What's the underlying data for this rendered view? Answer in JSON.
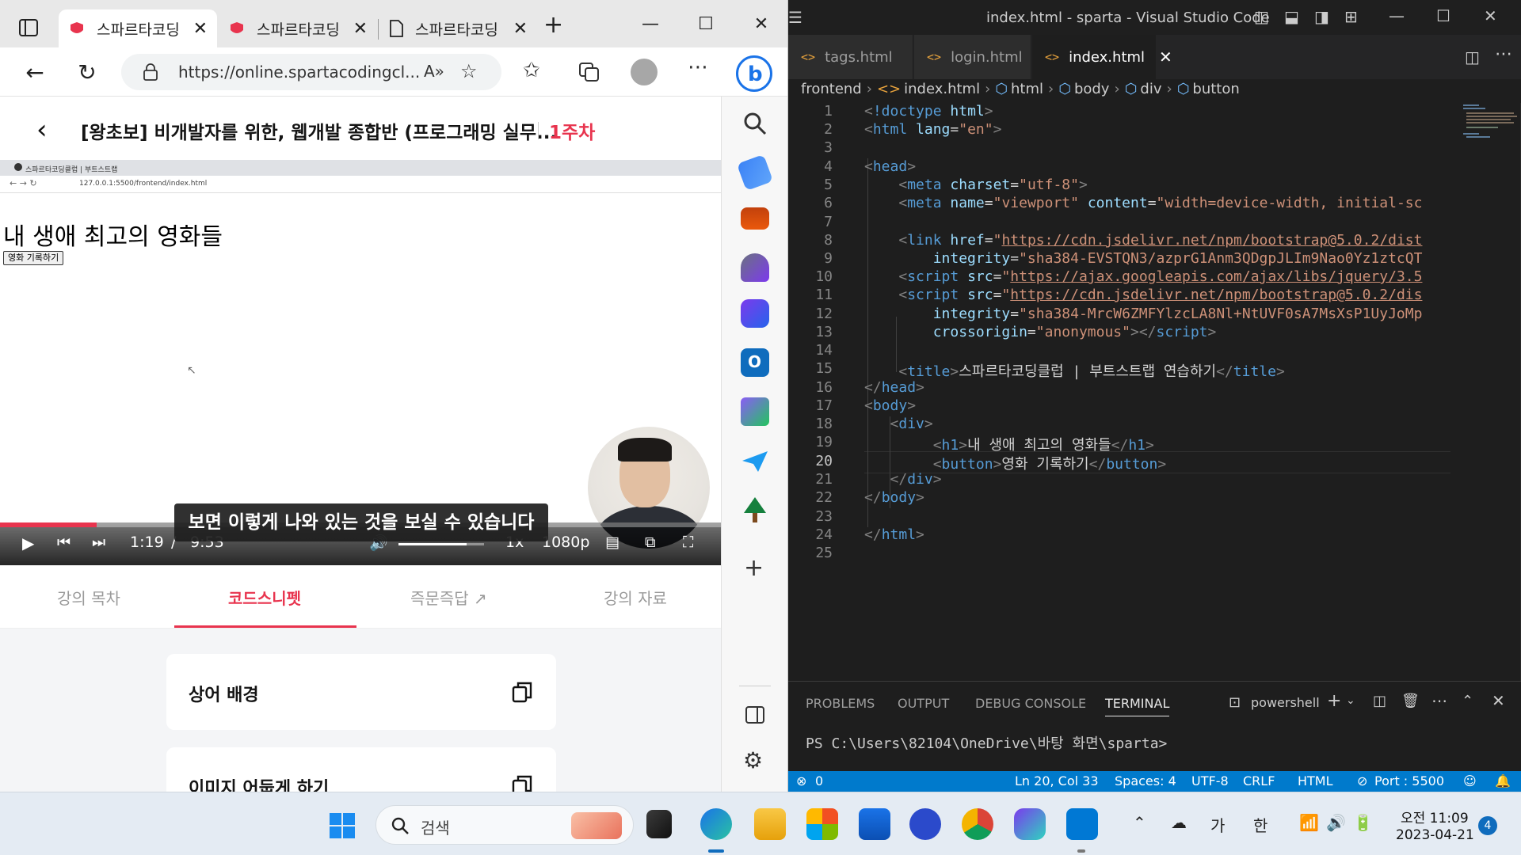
{
  "browser": {
    "tabs": [
      {
        "label": "스파르타코딩",
        "active": true
      },
      {
        "label": "스파르타코딩",
        "active": false
      },
      {
        "label": "스파르타코딩",
        "active": false
      }
    ],
    "tab_close": "✕",
    "new_tab": "+",
    "url": "https://online.spartacodingcl...",
    "window_buttons": {
      "minimize": "—",
      "maximize": "☐",
      "close": "✕"
    }
  },
  "course": {
    "title": "[왕초보] 비개발자를 위한, 웹개발 종합반 (프로그래밍 실무...",
    "week": "1주차",
    "tabs": [
      "강의 목차",
      "코드스니펫",
      "즉문즉답",
      "강의 자료"
    ],
    "active_tab": "코드스니펫",
    "snippets": [
      "상어 배경",
      "이미지 어둡게 하기"
    ]
  },
  "video": {
    "mini_tab": "스파르타코딩클럽 | 부트스트랩",
    "mini_url": "127.0.0.1:5500/frontend/index.html",
    "h1": "내 생애 최고의 영화들",
    "button": "영화 기록하기",
    "subtitle": "보면 이렇게 나와 있는 것을 보실 수 있습니다",
    "current_time": "1:19",
    "time_sep": "/",
    "duration": "9:53",
    "speed": "1x",
    "quality": "1080p",
    "progress_fraction": 0.134,
    "volume_fraction": 0.8
  },
  "vscode": {
    "title": "index.html - sparta - Visual Studio Code",
    "tabs": [
      "tags.html",
      "login.html",
      "index.html"
    ],
    "tab_close": "✕",
    "breadcrumb": [
      "frontend",
      "index.html",
      "html",
      "body",
      "div",
      "button"
    ],
    "line_numbers": [
      "1",
      "2",
      "3",
      "4",
      "5",
      "6",
      "7",
      "8",
      "9",
      "10",
      "11",
      "12",
      "13",
      "14",
      "15",
      "16",
      "17",
      "18",
      "19",
      "20",
      "21",
      "22",
      "23",
      "24",
      "25"
    ],
    "code": {
      "l1_kw": "!doctype",
      "l1_tag": "html",
      "l2_tag": "html",
      "l2_attr": "lang",
      "l2_val": "\"en\"",
      "l4_tag": "head",
      "l5_tag": "meta",
      "l5_attr": "charset",
      "l5_val": "\"utf-8\"",
      "l6_tag": "meta",
      "l6_attr1": "name",
      "l6_val1": "\"viewport\"",
      "l6_attr2": "content",
      "l6_val2": "\"width=device-width, initial-sc",
      "l8_tag": "link",
      "l8_attr": "href",
      "l8_val": "https://cdn.jsdelivr.net/npm/bootstrap@5.0.2/dist",
      "l9_attr": "integrity",
      "l9_val": "\"sha384-EVSTQN3/azprG1Anm3QDgpJLIm9Nao0Yz1ztcQT",
      "l10_tag": "script",
      "l10_attr": "src",
      "l10_val": "https://ajax.googleapis.com/ajax/libs/jquery/3.5",
      "l11_tag": "script",
      "l11_attr": "src",
      "l11_val": "https://cdn.jsdelivr.net/npm/bootstrap@5.0.2/dis",
      "l12_attr": "integrity",
      "l12_val": "\"sha384-MrcW6ZMFYlzcLA8Nl+NtUVF0sA7MsXsP1UyJoMp",
      "l13_attr": "crossorigin",
      "l13_val": "\"anonymous\"",
      "l13_close": "script",
      "l15_tag": "title",
      "l15_text": "스파르타코딩클럽 | 부트스트랩 연습하기",
      "l15_close": "title",
      "l16_tag": "head",
      "l17_tag": "body",
      "l18_tag": "div",
      "l19_tag": "h1",
      "l19_text": "내 생애 최고의 영화들",
      "l19_close": "h1",
      "l20_tag": "button",
      "l20_text": "영화 기록하기",
      "l20_close": "button",
      "l21_tag": "div",
      "l22_tag": "body",
      "l24_tag": "html"
    },
    "panel_tabs": [
      "PROBLEMS",
      "OUTPUT",
      "DEBUG CONSOLE",
      "TERMINAL"
    ],
    "terminal_name": "powershell",
    "prompt": "PS C:\\Users\\82104\\OneDrive\\바탕 화면\\sparta>",
    "status": {
      "errors": "0",
      "position": "Ln 20, Col 33",
      "spaces": "Spaces: 4",
      "encoding": "UTF-8",
      "eol": "CRLF",
      "language": "HTML",
      "port": "Port : 5500"
    }
  },
  "taskbar": {
    "search": "검색",
    "tray_ime1": "가",
    "tray_ime2": "한",
    "time": "오전 11:09",
    "date": "2023-04-21",
    "notifications": "4"
  },
  "colors": {
    "accent_red": "#e8344e",
    "vscode_blue": "#007acc"
  }
}
